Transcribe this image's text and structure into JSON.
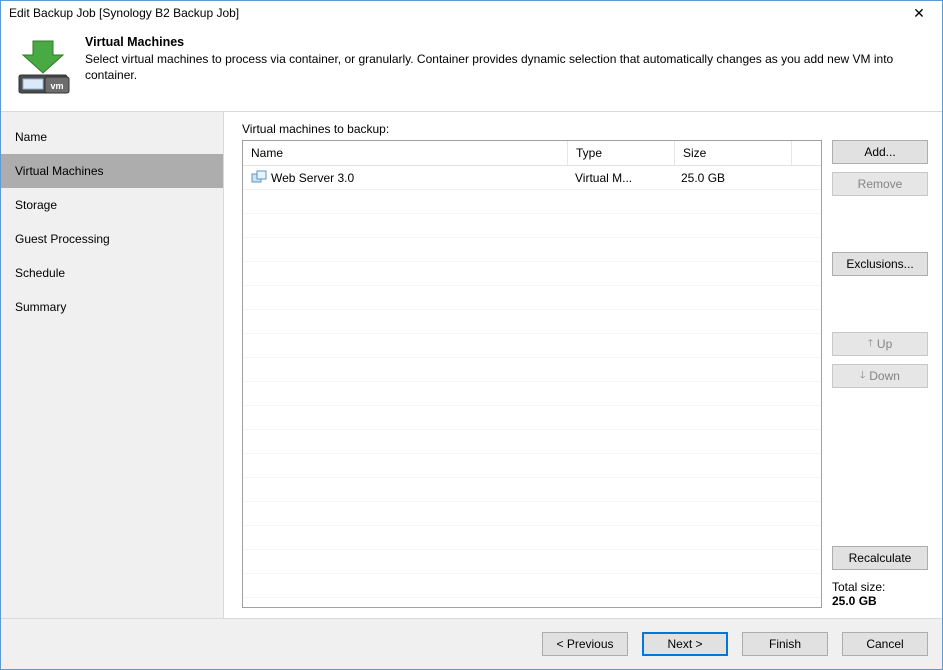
{
  "window_title": "Edit Backup Job [Synology B2 Backup Job]",
  "banner": {
    "heading": "Virtual Machines",
    "subheading": "Select virtual machines to process via container, or granularly. Container provides dynamic selection that automatically changes as you add new VM into container."
  },
  "sidebar": {
    "items": [
      {
        "label": "Name",
        "selected": false
      },
      {
        "label": "Virtual Machines",
        "selected": true
      },
      {
        "label": "Storage",
        "selected": false
      },
      {
        "label": "Guest Processing",
        "selected": false
      },
      {
        "label": "Schedule",
        "selected": false
      },
      {
        "label": "Summary",
        "selected": false
      }
    ]
  },
  "main": {
    "list_label": "Virtual machines to backup:",
    "columns": {
      "name": "Name",
      "type": "Type",
      "size": "Size"
    },
    "rows": [
      {
        "name": "Web Server 3.0",
        "type": "Virtual M...",
        "size": "25.0 GB"
      }
    ]
  },
  "side_buttons": {
    "add": "Add...",
    "remove": "Remove",
    "exclusions": "Exclusions...",
    "up": "Up",
    "down": "Down",
    "recalculate": "Recalculate"
  },
  "total": {
    "label": "Total size:",
    "value": "25.0 GB"
  },
  "footer": {
    "previous": "< Previous",
    "next": "Next >",
    "finish": "Finish",
    "cancel": "Cancel"
  }
}
